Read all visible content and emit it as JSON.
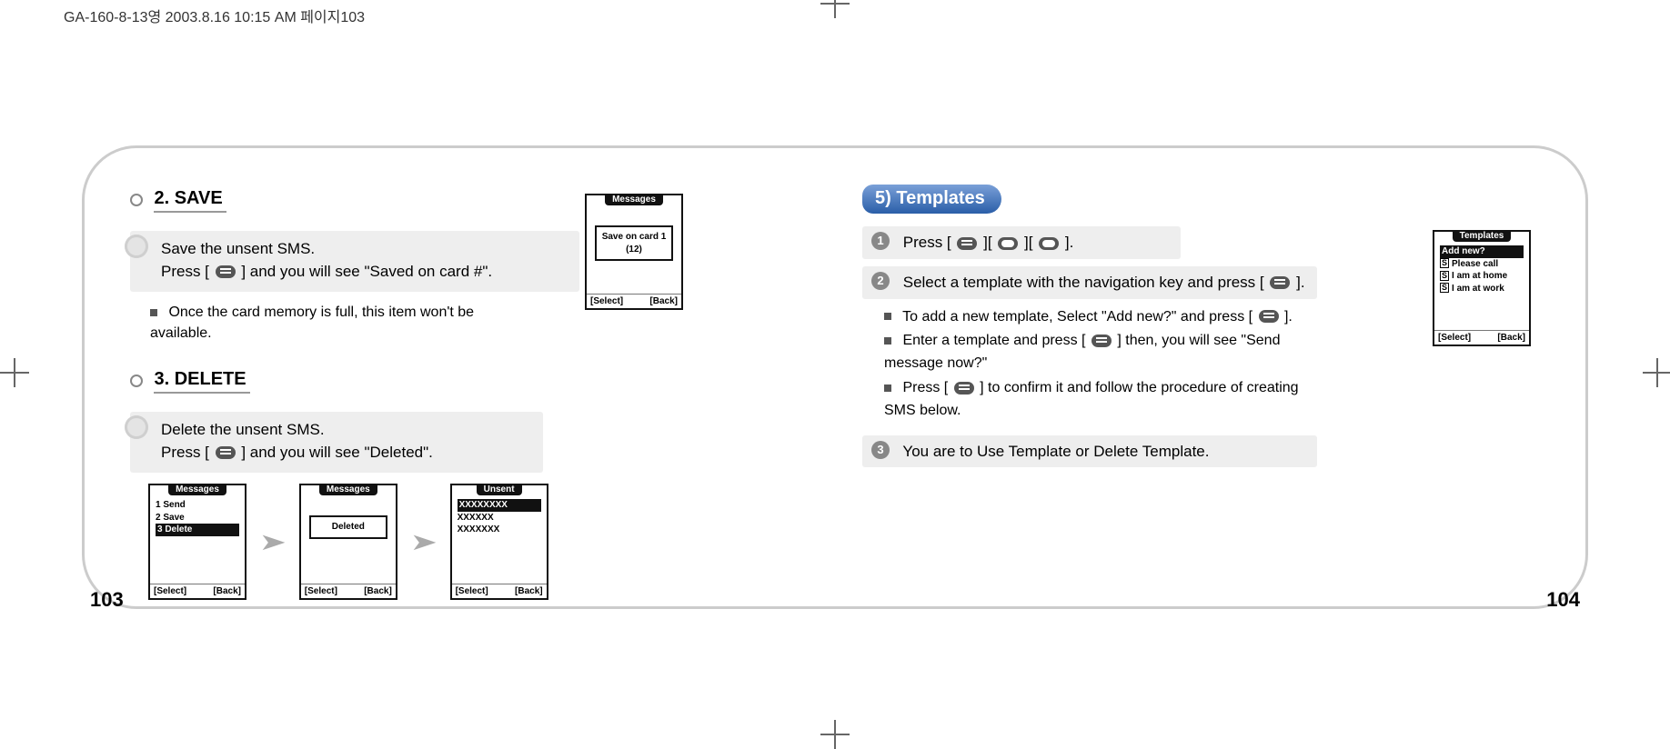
{
  "header": "GA-160-8-13영    2003.8.16 10:15 AM    페이지103",
  "left": {
    "save": {
      "title": "2. SAVE",
      "line1": "Save the unsent SMS.",
      "line2_a": "Press [ ",
      "line2_b": " ] and you will see \"Saved on card #\".",
      "note": "Once the  card memory is full,  this item won't be available."
    },
    "del": {
      "title": "3. DELETE",
      "line1": "Delete the unsent SMS.",
      "line2_a": "Press [ ",
      "line2_b": " ] and you will see \"Deleted\"."
    },
    "phones": {
      "save_tab": "Messages",
      "save_popup": "Save on card 1 (12)",
      "del1_tab": "Messages",
      "del1_r1": "1 Send",
      "del1_r2": "2 Save",
      "del1_r3": "3 Delete",
      "del2_tab": "Messages",
      "del2_popup": "Deleted",
      "del3_tab": "Unsent",
      "del3_r1": "XXXXXXXX",
      "del3_r2": "XXXXXX",
      "del3_r3": "XXXXXXX",
      "sk_l": "[Select]",
      "sk_r": "[Back]"
    },
    "page": "103"
  },
  "right": {
    "pill": "5) Templates",
    "s1_a": "Press [ ",
    "s1_b": " ][ ",
    "s1_c": " ][ ",
    "s1_d": " ].",
    "s2_a": "Select a template with the navigation key and press [ ",
    "s2_b": " ].",
    "b1_a": "To add a new template, Select \"Add new?\" and press [ ",
    "b1_b": " ].",
    "b2_a": "Enter a template and press [ ",
    "b2_b": " ] then, you will see \"Send message now?\"",
    "b3_a": "Press [ ",
    "b3_b": " ] to confirm it and follow the procedure of creating SMS below.",
    "s3": "You are to Use Template or Delete Template.",
    "phone": {
      "tab": "Templates",
      "r0": "Add new?",
      "r1": "Please call",
      "r2": "I am at home",
      "r3": "I am at work",
      "sk_l": "[Select]",
      "sk_r": "[Back]"
    },
    "page": "104"
  },
  "nums": {
    "n1": "1",
    "n2": "2",
    "n3": "3"
  },
  "icon_s": "S"
}
